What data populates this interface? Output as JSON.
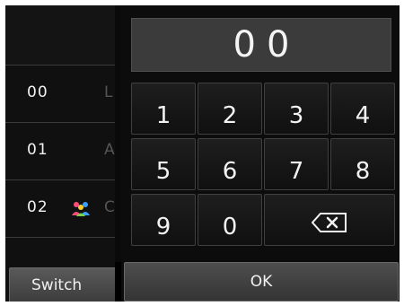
{
  "entry": {
    "value": "00"
  },
  "list": {
    "rows": [
      {
        "number": "00",
        "name_fragment": "L",
        "group": false
      },
      {
        "number": "01",
        "name_fragment": "A",
        "group": false
      },
      {
        "number": "02",
        "name_fragment": "C",
        "group": true
      }
    ],
    "switch_label": "Switch"
  },
  "keypad": {
    "keys": [
      "1",
      "2",
      "3",
      "4",
      "5",
      "6",
      "7",
      "8",
      "9",
      "0"
    ],
    "backspace_icon": "backspace-icon",
    "ok_label": "OK"
  },
  "colors": {
    "background": "#000000",
    "key_text": "#f2f2f2",
    "display_bg": "#3b3b3b"
  }
}
